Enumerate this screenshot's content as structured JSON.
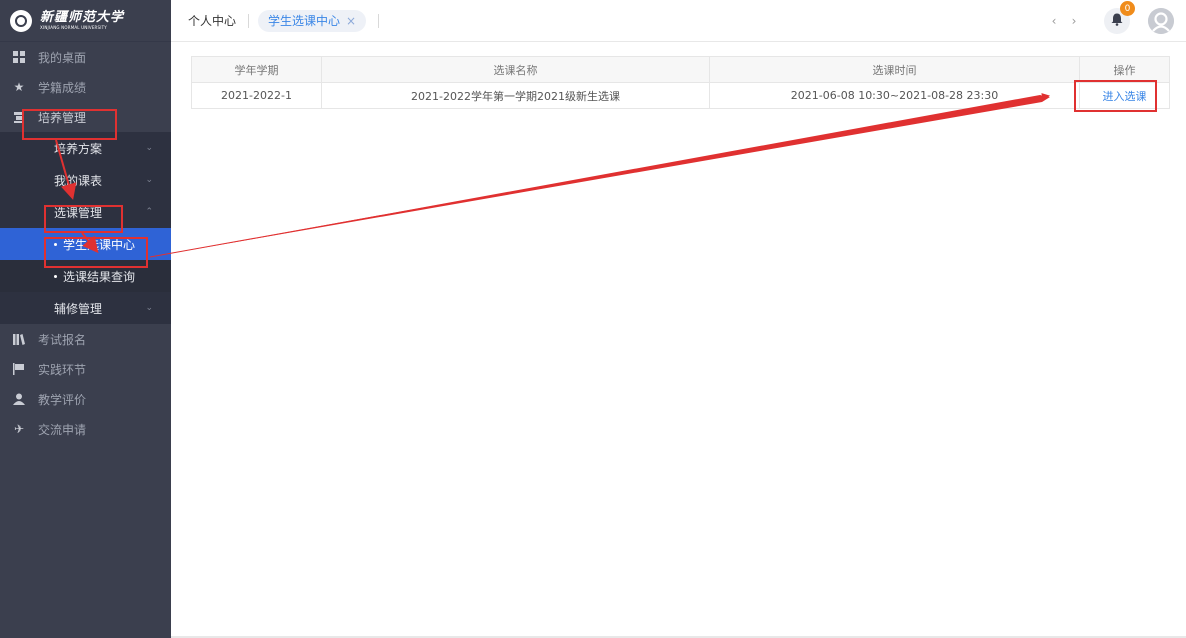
{
  "logo": {
    "cn": "新疆师范大学",
    "en": "XINJIANG NORMAL UNIVERSITY"
  },
  "sidebar": {
    "items": [
      {
        "label": "我的桌面",
        "icon": "grid-icon"
      },
      {
        "label": "学籍成绩",
        "icon": "star-icon"
      },
      {
        "label": "培养管理",
        "icon": "graduation-icon"
      },
      {
        "label": "考试报名",
        "icon": "books-icon"
      },
      {
        "label": "实践环节",
        "icon": "flag-icon"
      },
      {
        "label": "教学评价",
        "icon": "user-icon"
      },
      {
        "label": "交流申请",
        "icon": "plane-icon"
      }
    ],
    "sub": {
      "peiyang_fangan": "培养方案",
      "wode_kebiao": "我的课表",
      "xuanke_guanli": "选课管理",
      "xuesheng_xuanke": "学生选课中心",
      "xuanke_jieguo": "选课结果查询",
      "fuxiu_guanli": "辅修管理"
    }
  },
  "header": {
    "home": "个人中心",
    "active_tab": "学生选课中心",
    "tab_close": "×",
    "prev": "‹",
    "next": "›",
    "notifications": "0"
  },
  "table": {
    "headers": [
      "学年学期",
      "选课名称",
      "选课时间",
      "操作"
    ],
    "rows": [
      {
        "term": "2021-2022-1",
        "name": "2021-2022学年第一学期2021级新生选课",
        "time": "2021-06-08 10:30~2021-08-28 23:30",
        "action": "进入选课"
      }
    ]
  },
  "colors": {
    "sidebar_bg": "#3b3f4e",
    "accent": "#2f63d6",
    "link": "#3a86e6",
    "annotation": "#e03131",
    "badge": "#f08c1b"
  }
}
